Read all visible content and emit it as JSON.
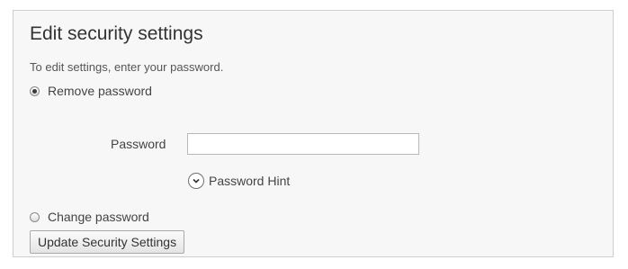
{
  "panel": {
    "title": "Edit security settings",
    "instruction": "To edit settings, enter your password."
  },
  "options": {
    "remove_password": {
      "label": "Remove password",
      "checked": true
    },
    "change_password": {
      "label": "Change password",
      "checked": false
    }
  },
  "password_field": {
    "label": "Password",
    "value": "",
    "placeholder": ""
  },
  "hint": {
    "label": "Password Hint",
    "icon": "chevron-down-icon"
  },
  "actions": {
    "update_label": "Update Security Settings"
  }
}
